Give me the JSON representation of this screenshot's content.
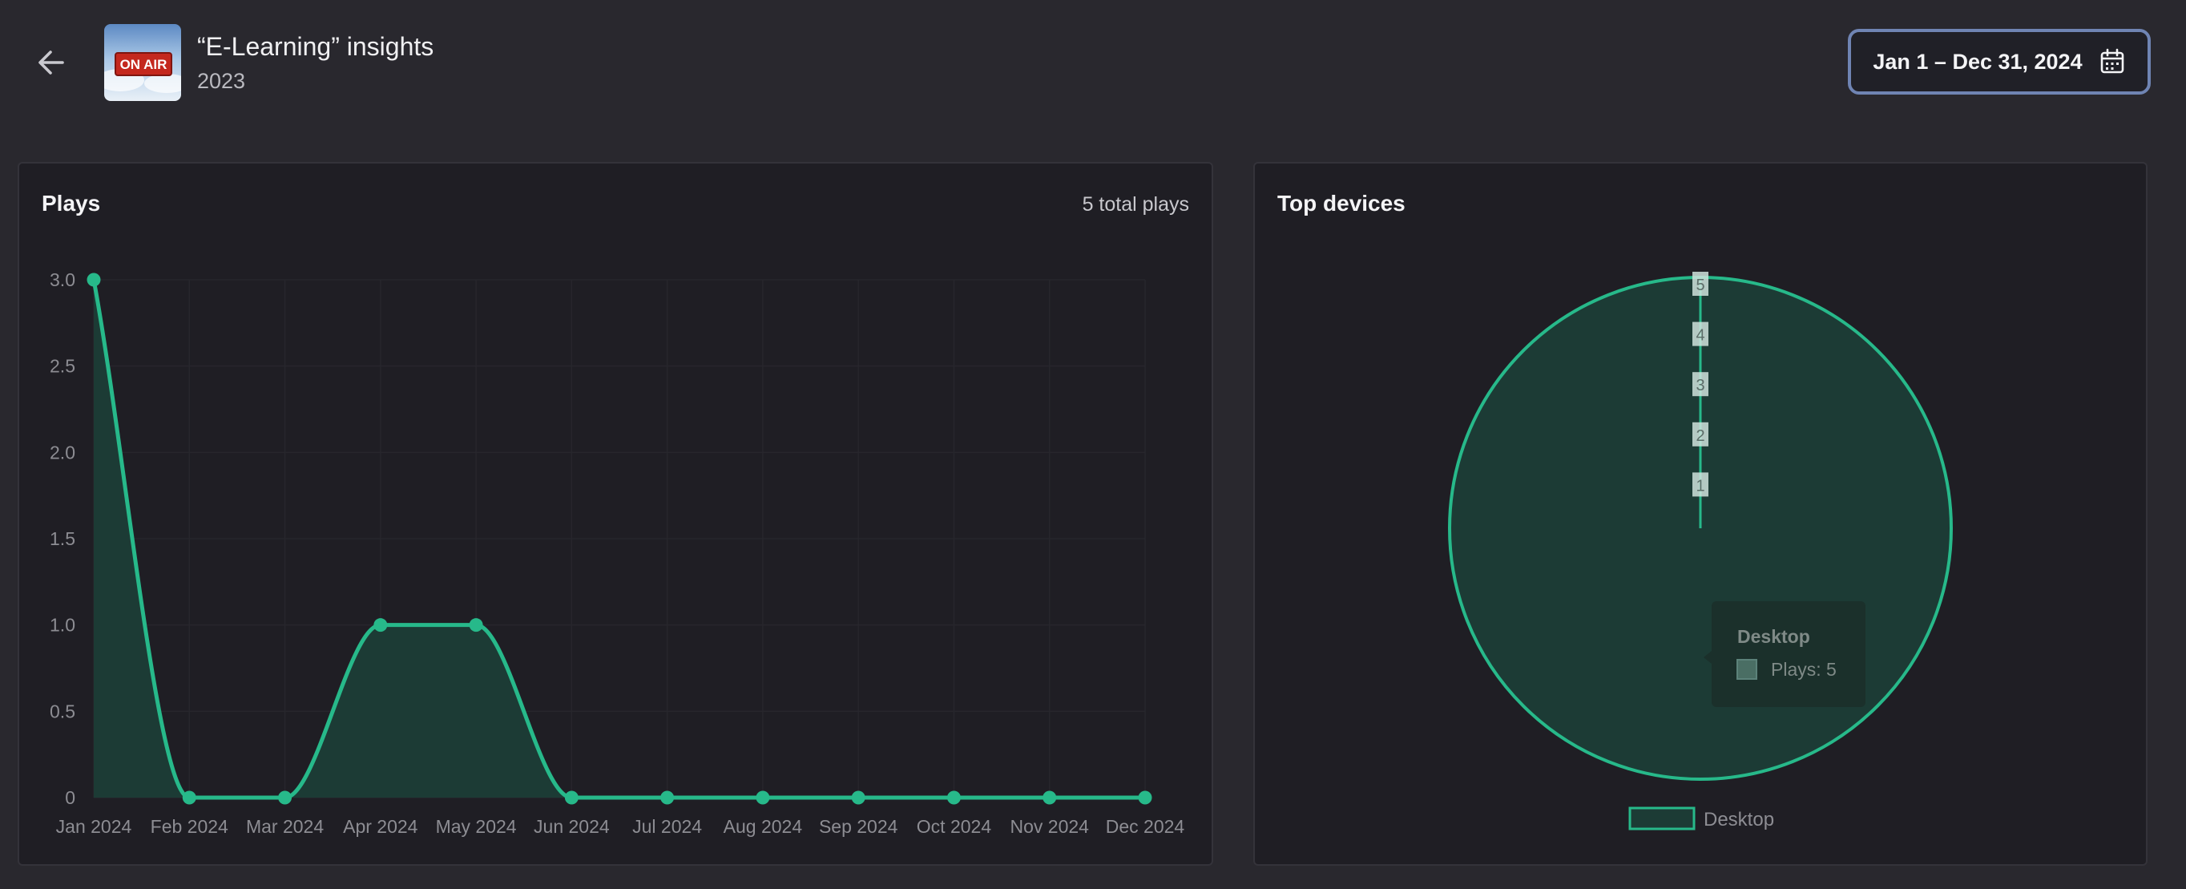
{
  "header": {
    "title": "“E-Learning” insights",
    "subtitle": "2023",
    "date_range": "Jan 1 – Dec 31, 2024",
    "thumbnail_text": "ON AIR",
    "back_icon": "arrow-left-icon",
    "calendar_icon": "calendar-icon"
  },
  "plays_panel": {
    "title": "Plays",
    "total_label": "5 total plays"
  },
  "devices_panel": {
    "title": "Top devices",
    "tooltip_title": "Desktop",
    "tooltip_value": "Plays: 5"
  },
  "colors": {
    "accent": "#27b98a",
    "fill": "#1c3b35",
    "background": "#29282e",
    "panel": "#1f1e24"
  },
  "chart_data": [
    {
      "type": "area",
      "categories": [
        "Jan 2024",
        "Feb 2024",
        "Mar 2024",
        "Apr 2024",
        "May 2024",
        "Jun 2024",
        "Jul 2024",
        "Aug 2024",
        "Sep 2024",
        "Oct 2024",
        "Nov 2024",
        "Dec 2024"
      ],
      "values": [
        3,
        0,
        0,
        1,
        1,
        0,
        0,
        0,
        0,
        0,
        0,
        0
      ],
      "y_ticks": [
        "0",
        "0.5",
        "1.0",
        "1.5",
        "2.0",
        "2.5",
        "3.0"
      ],
      "ylim": [
        0,
        3
      ],
      "grid": true
    },
    {
      "type": "pie",
      "labels": [
        "Desktop"
      ],
      "values": [
        5
      ],
      "radial_ticks": [
        "1",
        "2",
        "3",
        "4",
        "5"
      ],
      "legend": [
        "Desktop"
      ],
      "legend_position": "bottom"
    }
  ]
}
